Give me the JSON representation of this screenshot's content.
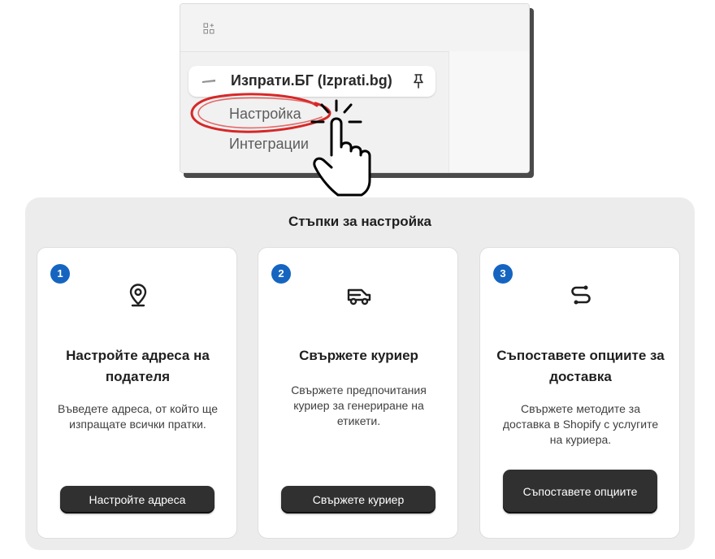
{
  "menu": {
    "app_name": "Изпрати.БГ (Izprati.bg)",
    "items": [
      {
        "label": "Настройка"
      },
      {
        "label": "Интеграции"
      }
    ]
  },
  "setup": {
    "title": "Стъпки за настройка",
    "steps": [
      {
        "number": "1",
        "icon": "location-pin-icon",
        "title": "Настройте адреса на подателя",
        "description": "Въведете адреса, от който ще изпращате всички пратки.",
        "button": "Настройте адреса"
      },
      {
        "number": "2",
        "icon": "delivery-truck-icon",
        "title": "Свържете куриер",
        "description": "Свържете предпочитания куриер за генериране на етикети.",
        "button": "Свържете куриер"
      },
      {
        "number": "3",
        "icon": "connect-link-icon",
        "title": "Съпоставете опциите за доставка",
        "description": "Свържете методите за доставка в Shopify с услугите на куриера.",
        "button": "Съпоставете опциите"
      }
    ]
  },
  "colors": {
    "accent": "#1565c0",
    "button": "#303030",
    "highlight": "#d62828"
  }
}
